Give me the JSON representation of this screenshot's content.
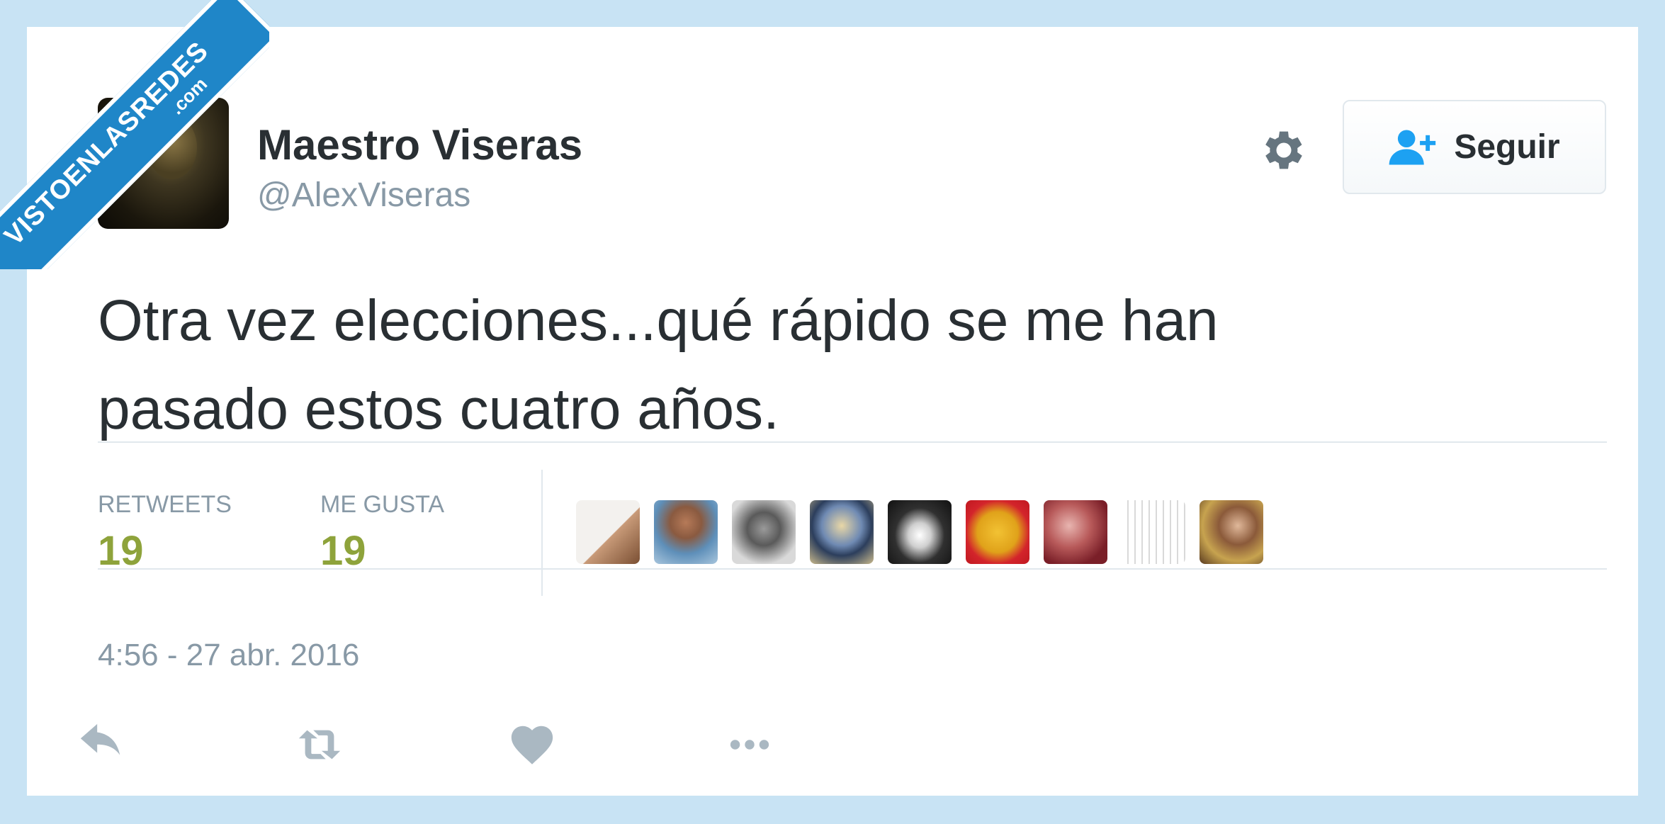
{
  "user": {
    "display_name": "Maestro Viseras",
    "handle": "@AlexViseras"
  },
  "follow_button": {
    "label": "Seguir"
  },
  "tweet": {
    "text_line1": "Otra vez elecciones...qué rápido se me han",
    "text_line2": "pasado estos cuatro años."
  },
  "stats": {
    "retweets_label": "RETWEETS",
    "retweets_value": "19",
    "likes_label": "ME GUSTA",
    "likes_value": "19"
  },
  "timestamp": "4:56 - 27 abr. 2016",
  "watermark": {
    "main": "VISTOENLASREDES",
    "sub": ".com"
  },
  "colors": {
    "background": "#c8e3f4",
    "stat_value": "#8ea33b",
    "muted": "#8899a6",
    "text": "#292f33",
    "follow_icon": "#1da1f2",
    "badge": "#1f86c8"
  },
  "icons": [
    "gear-icon",
    "add-user-icon",
    "reply-icon",
    "retweet-icon",
    "heart-icon",
    "more-icon"
  ]
}
